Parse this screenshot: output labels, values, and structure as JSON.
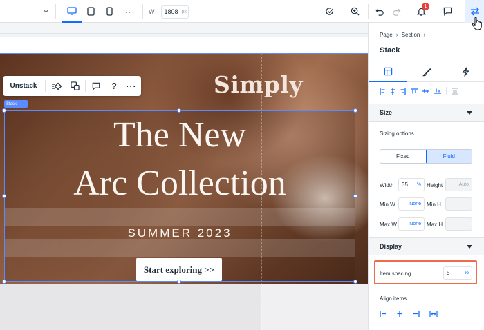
{
  "toolbar": {
    "width_label": "W",
    "width_value": "1808",
    "width_unit": "px",
    "notification_count": "1",
    "accent": "#116dff"
  },
  "canvas": {
    "brand": "Simply",
    "title_line1": "The New",
    "title_line2": "Arc Collection",
    "subtitle": "SUMMER 2023",
    "cta": "Start exploring >>",
    "selection_tag": "Stack"
  },
  "action_bar": {
    "unstack_label": "Unstack",
    "help_label": "?",
    "more_label": "···"
  },
  "panel": {
    "breadcrumb": [
      "Page",
      "Section"
    ],
    "title": "Stack",
    "size_section": "Size",
    "sizing_options_label": "Sizing options",
    "sizing_fixed": "Fixed",
    "sizing_fluid": "Fluid",
    "width_label": "Width",
    "width_value": "35",
    "width_unit": "%",
    "height_label": "Height",
    "height_value": "Auto",
    "min_w_label": "Min W",
    "min_w_value": "None",
    "min_h_label": "Min H",
    "max_w_label": "Max W",
    "max_w_value": "None",
    "max_h_label": "Max H",
    "display_section": "Display",
    "item_spacing_label": "Item spacing",
    "item_spacing_value": "5",
    "item_spacing_unit": "%",
    "align_items_label": "Align items",
    "highlight_color": "#f06b4b"
  }
}
